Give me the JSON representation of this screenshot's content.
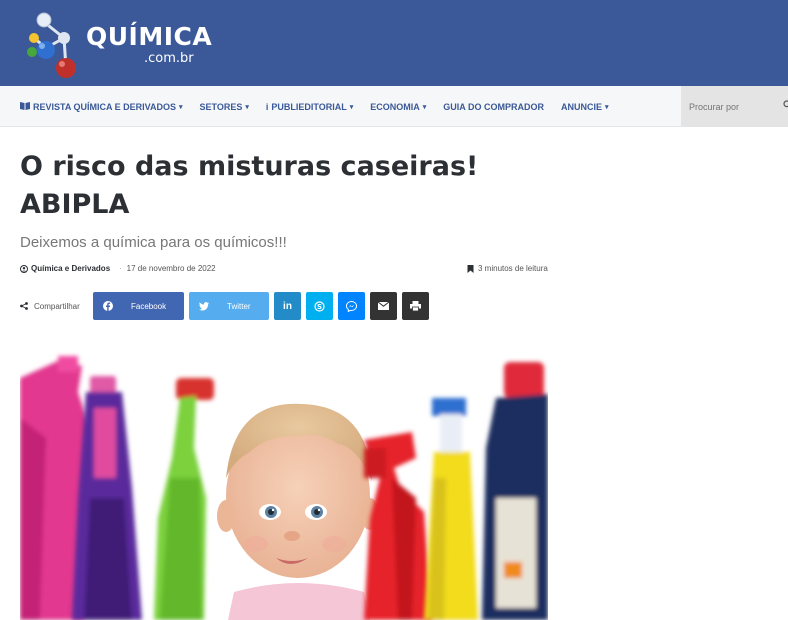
{
  "header": {
    "logo_text": "QUÍMICA",
    "logo_subtext": ".com.br",
    "background_color": "#3b5998"
  },
  "nav": {
    "items": [
      {
        "label": "REVISTA QUÍMICA E DERIVADOS",
        "icon": "book-icon",
        "dropdown": true
      },
      {
        "label": "SETORES",
        "dropdown": true
      },
      {
        "label": "PUBLIEDITORIAL",
        "icon": "info-icon",
        "dropdown": true
      },
      {
        "label": "ECONOMIA",
        "dropdown": true
      },
      {
        "label": "GUIA DO COMPRADOR",
        "dropdown": false
      },
      {
        "label": "ANUNCIE",
        "dropdown": true
      }
    ],
    "search": {
      "placeholder": "Procurar por"
    }
  },
  "article": {
    "title_line1": "O risco das misturas caseiras!",
    "title_line2": "ABIPLA",
    "subtitle": "Deixemos a química para os químicos!!!",
    "author": "Química e Derivados",
    "date": "17 de novembro de 2022",
    "reading_time": "3 minutos de leitura"
  },
  "share": {
    "label": "Compartilhar",
    "facebook": "Facebook",
    "twitter": "Twitter"
  }
}
